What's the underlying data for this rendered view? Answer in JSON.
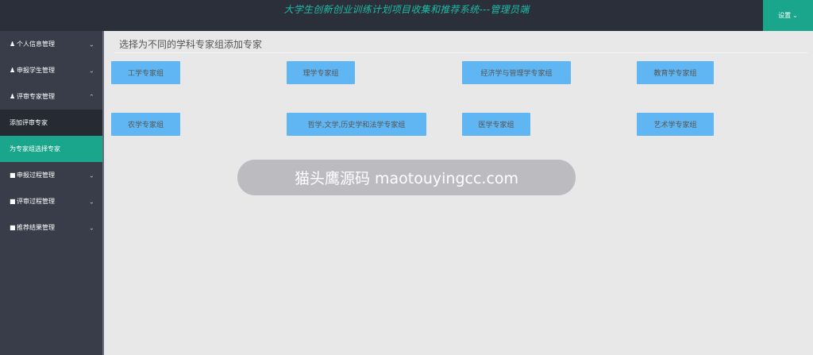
{
  "header": {
    "app_title": "大学生创新创业训练计划项目收集和推荐系统---管理员端",
    "settings_label": "设置",
    "settings_icon": "chevron-down-icon"
  },
  "sidebar": {
    "items": [
      {
        "label": "个人信息管理",
        "icon": "user-icon",
        "expanded": false
      },
      {
        "label": "申报学生管理",
        "icon": "users-icon",
        "expanded": false
      },
      {
        "label": "评审专家管理",
        "icon": "users-icon",
        "expanded": true
      },
      {
        "label": "申报过程管理",
        "icon": "chat-icon",
        "expanded": false
      },
      {
        "label": "评审过程管理",
        "icon": "chat-icon",
        "expanded": false
      },
      {
        "label": "推荐结果管理",
        "icon": "chat-icon",
        "expanded": false
      }
    ],
    "sub_items": [
      {
        "label": "添加评审专家",
        "active": false
      },
      {
        "label": "为专家组选择专家",
        "active": true
      }
    ]
  },
  "main": {
    "heading": "选择为不同的学科专家组添加专家",
    "groups": [
      "工学专家组",
      "理学专家组",
      "经济学与管理学专家组",
      "教育学专家组",
      "农学专家组",
      "哲学,文学,历史学和法学专家组",
      "医学专家组",
      "艺术学专家组"
    ]
  },
  "overlay": {
    "text": "猫头鹰源码 maotouyingcc.com"
  },
  "colors": {
    "header_bg": "#2b2f3a",
    "title": "#1fbba6",
    "accent": "#1aa68c",
    "sidebar_bg": "#393d49",
    "button": "#5fb6f3"
  }
}
